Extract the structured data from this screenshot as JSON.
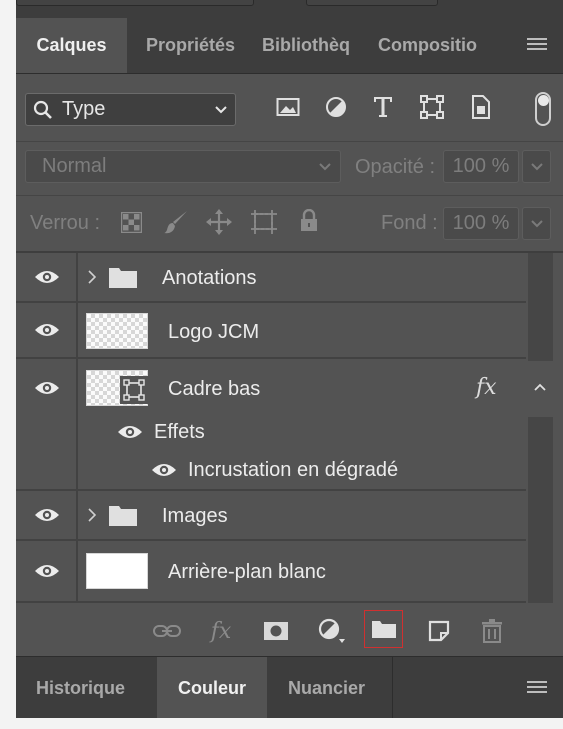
{
  "tabs": [
    {
      "label": "Calques",
      "active": true
    },
    {
      "label": "Propriétés",
      "active": false
    },
    {
      "label": "Bibliothèq",
      "active": false
    },
    {
      "label": "Compositio",
      "active": false
    }
  ],
  "filter": {
    "kind_value": "Type",
    "icons": [
      "image-filter-icon",
      "adjustment-filter-icon",
      "type-filter-icon",
      "shape-filter-icon",
      "smart-object-filter-icon"
    ]
  },
  "blend": {
    "mode_value": "Normal",
    "opacity_label": "Opacité :",
    "opacity_value": "100 %"
  },
  "lock": {
    "label": "Verrou :",
    "fill_label": "Fond :",
    "fill_value": "100 %"
  },
  "layers": [
    {
      "name": "Anotations",
      "kind": "group"
    },
    {
      "name": "Logo JCM",
      "kind": "pixel"
    },
    {
      "name": "Cadre bas",
      "kind": "shape",
      "fx": "fx"
    },
    {
      "name": "Images",
      "kind": "group"
    },
    {
      "name": "Arrière-plan blanc",
      "kind": "solid"
    }
  ],
  "effects": {
    "label": "Effets",
    "items": [
      "Incrustation en dégradé"
    ]
  },
  "bottom_actions": {
    "fx_label": "fx",
    "icons": [
      "link-icon",
      "fx-icon",
      "mask-icon",
      "adjustment-layer-icon",
      "new-group-icon",
      "new-layer-icon",
      "trash-icon"
    ],
    "highlighted": "new-group-icon",
    "highlight_color": "#d03030"
  },
  "bottom_tabs": [
    {
      "label": "Historique",
      "active": false
    },
    {
      "label": "Couleur",
      "active": true
    },
    {
      "label": "Nuancier",
      "active": false
    }
  ],
  "colors": {
    "panel": "#535353",
    "tabbar": "#3d3d3d",
    "text": "#ececec"
  }
}
